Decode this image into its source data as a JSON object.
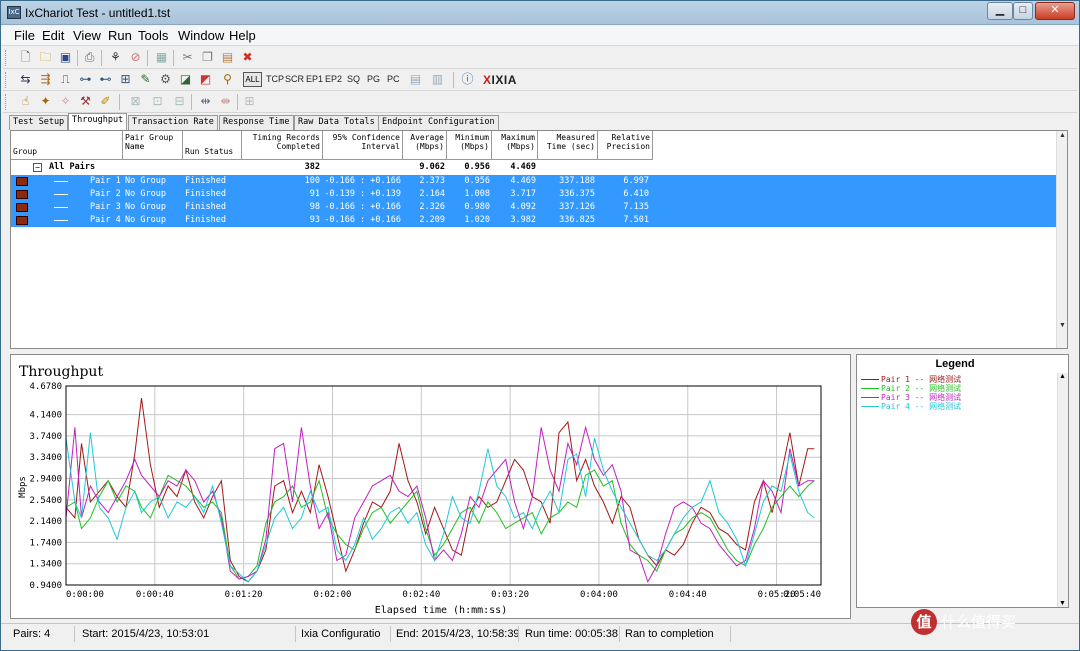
{
  "window": {
    "title": "IxChariot Test - untitled1.tst",
    "icon_text": "IxC"
  },
  "menu": [
    "File",
    "Edit",
    "View",
    "Run",
    "Tools",
    "Window",
    "Help"
  ],
  "toolbar3_text": {
    "all": "ALL",
    "tcp": "TCP",
    "scr": "SCR",
    "ep1": "EP1",
    "ep2": "EP2",
    "sq": "SQ",
    "pg": "PG",
    "pc": "PC",
    "brand": "IXIA",
    "brand_x": "X"
  },
  "tabs": [
    "Test Setup",
    "Throughput",
    "Transaction Rate",
    "Response Time",
    "Raw Data Totals",
    "Endpoint Configuration"
  ],
  "active_tab": "Throughput",
  "table": {
    "headers": [
      "Group",
      "Pair Group Name",
      "Run Status",
      "Timing Records Completed",
      "95% Confidence Interval",
      "Average (Mbps)",
      "Minimum (Mbps)",
      "Maximum (Mbps)",
      "Measured Time (sec)",
      "Relative Precision"
    ],
    "summary": {
      "label": "All Pairs",
      "timing": "382",
      "average": "9.062",
      "minimum": "0.956",
      "maximum": "4.469"
    },
    "rows": [
      {
        "pair": "Pair 1",
        "group": "No Group",
        "status": "Finished",
        "timing": "100",
        "ci": "-0.166 : +0.166",
        "avg": "2.373",
        "min": "0.956",
        "max": "4.469",
        "time": "337.188",
        "precision": "6.997"
      },
      {
        "pair": "Pair 2",
        "group": "No Group",
        "status": "Finished",
        "timing": "91",
        "ci": "-0.139 : +0.139",
        "avg": "2.164",
        "min": "1.008",
        "max": "3.717",
        "time": "336.375",
        "precision": "6.410"
      },
      {
        "pair": "Pair 3",
        "group": "No Group",
        "status": "Finished",
        "timing": "98",
        "ci": "-0.166 : +0.166",
        "avg": "2.326",
        "min": "0.980",
        "max": "4.092",
        "time": "337.126",
        "precision": "7.135"
      },
      {
        "pair": "Pair 4",
        "group": "No Group",
        "status": "Finished",
        "timing": "93",
        "ci": "-0.166 : +0.166",
        "avg": "2.209",
        "min": "1.020",
        "max": "3.982",
        "time": "336.825",
        "precision": "7.501"
      }
    ]
  },
  "legend": {
    "title": "Legend",
    "items": [
      {
        "label": "Pair 1 -- 网络测试",
        "color": "#a01818"
      },
      {
        "label": "Pair 2 -- 网络测试",
        "color": "#20c020"
      },
      {
        "label": "Pair 3 -- 网络测试",
        "color": "#c020c0"
      },
      {
        "label": "Pair 4 -- 网络测试",
        "color": "#20c8d8"
      }
    ]
  },
  "chart_data": {
    "type": "line",
    "title": "Throughput",
    "xlabel": "Elapsed time (h:mm:ss)",
    "ylabel": "Mbps",
    "xlim": [
      0,
      340
    ],
    "ylim": [
      0.94,
      4.678
    ],
    "yticks": [
      "4.6780",
      "4.1400",
      "3.7400",
      "3.3400",
      "2.9400",
      "2.5400",
      "2.1400",
      "1.7400",
      "1.3400",
      "0.9400"
    ],
    "ytick_values": [
      4.678,
      4.14,
      3.74,
      3.34,
      2.94,
      2.54,
      2.14,
      1.74,
      1.34,
      0.94
    ],
    "xticks": [
      "0:00:00",
      "0:00:40",
      "0:01:20",
      "0:02:00",
      "0:02:40",
      "0:03:20",
      "0:04:00",
      "0:04:40",
      "0:05:20",
      "0:05:40"
    ],
    "xtick_values": [
      0,
      40,
      80,
      120,
      160,
      200,
      240,
      280,
      320,
      340
    ],
    "grid": true,
    "series": [
      {
        "name": "Pair 1 -- 网络测试",
        "color": "#a01818",
        "x": [
          0,
          4,
          7,
          11,
          15,
          19,
          23,
          27,
          31,
          34,
          38,
          42,
          46,
          50,
          54,
          58,
          62,
          66,
          70,
          74,
          78,
          82,
          86,
          90,
          94,
          98,
          102,
          106,
          110,
          114,
          118,
          122,
          126,
          130,
          134,
          138,
          142,
          146,
          150,
          154,
          158,
          162,
          166,
          170,
          174,
          178,
          182,
          186,
          190,
          194,
          198,
          202,
          206,
          210,
          214,
          218,
          222,
          226,
          230,
          234,
          238,
          242,
          246,
          250,
          254,
          258,
          262,
          266,
          270,
          274,
          278,
          282,
          286,
          290,
          294,
          298,
          302,
          306,
          310,
          314,
          318,
          322,
          326,
          330,
          334,
          337
        ],
        "y": [
          2.4,
          2.2,
          3.6,
          2.5,
          2.7,
          2.9,
          2.6,
          2.4,
          3.4,
          4.45,
          3.2,
          2.4,
          2.8,
          2.6,
          3.1,
          2.5,
          2.2,
          2.6,
          2.9,
          1.4,
          1.1,
          1.0,
          1.2,
          1.6,
          2.8,
          2.9,
          2.3,
          2.7,
          2.3,
          3.2,
          2.6,
          1.9,
          1.2,
          1.6,
          2.1,
          2.5,
          2.4,
          2.7,
          3.6,
          2.9,
          2.5,
          1.9,
          2.4,
          2.0,
          1.6,
          1.5,
          2.3,
          2.6,
          2.4,
          2.5,
          2.9,
          3.3,
          3.1,
          2.6,
          2.5,
          2.1,
          3.8,
          4.0,
          2.9,
          3.3,
          2.8,
          2.5,
          2.1,
          2.6,
          2.4,
          1.8,
          1.5,
          1.3,
          1.6,
          1.5,
          1.7,
          2.1,
          2.4,
          2.3,
          2.0,
          1.9,
          1.7,
          1.6,
          2.5,
          2.9,
          2.3,
          3.0,
          3.8,
          2.8,
          3.5,
          3.5
        ]
      },
      {
        "name": "Pair 2 -- 网络测试",
        "color": "#20c020",
        "x": [
          0,
          4,
          7,
          11,
          15,
          19,
          23,
          27,
          31,
          34,
          38,
          42,
          46,
          50,
          54,
          58,
          62,
          66,
          70,
          74,
          78,
          82,
          86,
          90,
          94,
          98,
          102,
          106,
          110,
          114,
          118,
          122,
          126,
          130,
          134,
          138,
          142,
          146,
          150,
          154,
          158,
          162,
          166,
          170,
          174,
          178,
          182,
          186,
          190,
          194,
          198,
          202,
          206,
          210,
          214,
          218,
          222,
          226,
          230,
          234,
          238,
          242,
          246,
          250,
          254,
          258,
          262,
          266,
          270,
          274,
          278,
          282,
          286,
          290,
          294,
          298,
          302,
          306,
          310,
          314,
          318,
          322,
          326,
          330,
          334,
          337
        ],
        "y": [
          2.4,
          2.5,
          2.0,
          2.2,
          2.6,
          2.9,
          2.5,
          2.8,
          2.7,
          2.4,
          2.2,
          2.6,
          3.0,
          2.9,
          2.8,
          2.6,
          2.4,
          2.5,
          2.3,
          1.3,
          1.05,
          1.1,
          1.3,
          2.1,
          2.5,
          2.6,
          2.8,
          2.4,
          2.5,
          2.9,
          2.2,
          1.9,
          1.7,
          1.6,
          2.0,
          2.3,
          2.4,
          2.1,
          2.3,
          2.5,
          2.7,
          2.0,
          1.5,
          1.7,
          2.0,
          2.3,
          2.4,
          2.1,
          2.5,
          2.3,
          2.0,
          2.1,
          2.2,
          2.3,
          1.9,
          2.2,
          2.3,
          2.5,
          2.4,
          3.0,
          3.1,
          2.8,
          2.9,
          2.1,
          1.7,
          1.5,
          1.4,
          1.2,
          1.6,
          1.9,
          2.0,
          2.2,
          2.3,
          2.2,
          1.9,
          1.6,
          1.4,
          1.3,
          1.7,
          2.0,
          2.4,
          2.6,
          2.8,
          2.6,
          2.8,
          2.9
        ]
      },
      {
        "name": "Pair 3 -- 网络测试",
        "color": "#c020c0",
        "x": [
          0,
          4,
          7,
          11,
          15,
          19,
          23,
          27,
          31,
          34,
          38,
          42,
          46,
          50,
          54,
          58,
          62,
          66,
          70,
          74,
          78,
          82,
          86,
          90,
          94,
          98,
          102,
          106,
          110,
          114,
          118,
          122,
          126,
          130,
          134,
          138,
          142,
          146,
          150,
          154,
          158,
          162,
          166,
          170,
          174,
          178,
          182,
          186,
          190,
          194,
          198,
          202,
          206,
          210,
          214,
          218,
          222,
          226,
          230,
          234,
          238,
          242,
          246,
          250,
          254,
          258,
          262,
          266,
          270,
          274,
          278,
          282,
          286,
          290,
          294,
          298,
          302,
          306,
          310,
          314,
          318,
          322,
          326,
          330,
          334,
          337
        ],
        "y": [
          2.2,
          3.9,
          2.2,
          2.8,
          2.5,
          2.3,
          2.6,
          2.9,
          3.3,
          3.0,
          2.8,
          2.6,
          2.9,
          2.8,
          3.1,
          2.9,
          2.5,
          2.7,
          2.2,
          1.2,
          1.05,
          1.1,
          1.2,
          1.8,
          3.5,
          3.6,
          2.5,
          3.9,
          2.8,
          2.0,
          2.3,
          1.4,
          1.5,
          2.2,
          2.5,
          2.8,
          2.9,
          3.0,
          2.7,
          2.6,
          2.8,
          2.2,
          1.4,
          1.6,
          1.4,
          1.9,
          2.6,
          2.4,
          2.9,
          3.1,
          3.3,
          2.5,
          2.0,
          2.6,
          3.9,
          3.1,
          2.7,
          3.6,
          3.2,
          3.9,
          3.3,
          3.0,
          3.2,
          2.7,
          1.6,
          1.5,
          1.0,
          1.3,
          1.9,
          2.4,
          2.5,
          2.4,
          2.1,
          2.0,
          1.7,
          1.5,
          1.3,
          1.4,
          2.0,
          2.9,
          2.7,
          2.3,
          3.5,
          2.8,
          2.9,
          2.9
        ]
      },
      {
        "name": "Pair 4 -- 网络测试",
        "color": "#20c8d8",
        "x": [
          0,
          4,
          7,
          11,
          15,
          19,
          23,
          27,
          31,
          34,
          38,
          42,
          46,
          50,
          54,
          58,
          62,
          66,
          70,
          74,
          78,
          82,
          86,
          90,
          94,
          98,
          102,
          106,
          110,
          114,
          118,
          122,
          126,
          130,
          134,
          138,
          142,
          146,
          150,
          154,
          158,
          162,
          166,
          170,
          174,
          178,
          182,
          186,
          190,
          194,
          198,
          202,
          206,
          210,
          214,
          218,
          222,
          226,
          230,
          234,
          238,
          242,
          246,
          250,
          254,
          258,
          262,
          266,
          270,
          274,
          278,
          282,
          286,
          290,
          294,
          298,
          302,
          306,
          310,
          314,
          318,
          322,
          326,
          330,
          334,
          337
        ],
        "y": [
          3.7,
          2.5,
          2.2,
          3.8,
          2.4,
          2.2,
          1.8,
          2.4,
          2.7,
          2.3,
          2.5,
          2.6,
          2.2,
          2.5,
          2.4,
          2.6,
          2.3,
          2.8,
          2.1,
          1.3,
          1.15,
          1.0,
          1.2,
          1.7,
          2.2,
          2.4,
          2.0,
          2.2,
          2.7,
          2.3,
          2.4,
          1.6,
          1.4,
          1.7,
          2.2,
          1.8,
          2.0,
          2.3,
          2.4,
          2.1,
          2.3,
          1.7,
          1.4,
          1.9,
          2.6,
          2.2,
          2.1,
          2.7,
          3.5,
          2.8,
          2.6,
          2.2,
          2.3,
          2.0,
          2.4,
          2.7,
          2.3,
          3.3,
          3.4,
          2.6,
          3.7,
          3.1,
          2.7,
          2.4,
          2.1,
          1.8,
          1.5,
          1.4,
          1.6,
          1.9,
          2.2,
          2.4,
          2.5,
          2.9,
          2.3,
          2.1,
          1.8,
          1.3,
          1.9,
          2.5,
          2.8,
          2.7,
          3.4,
          2.7,
          2.3,
          2.2
        ]
      }
    ]
  },
  "status": {
    "pairs": "Pairs: 4",
    "start": "Start: 2015/4/23, 10:53:01",
    "config": "Ixia Configuratio",
    "end": "End: 2015/4/23, 10:58:39",
    "runtime": "Run time: 00:05:38",
    "result": "Ran to completion"
  },
  "watermark": {
    "logo": "值",
    "text": "什么值得买"
  }
}
